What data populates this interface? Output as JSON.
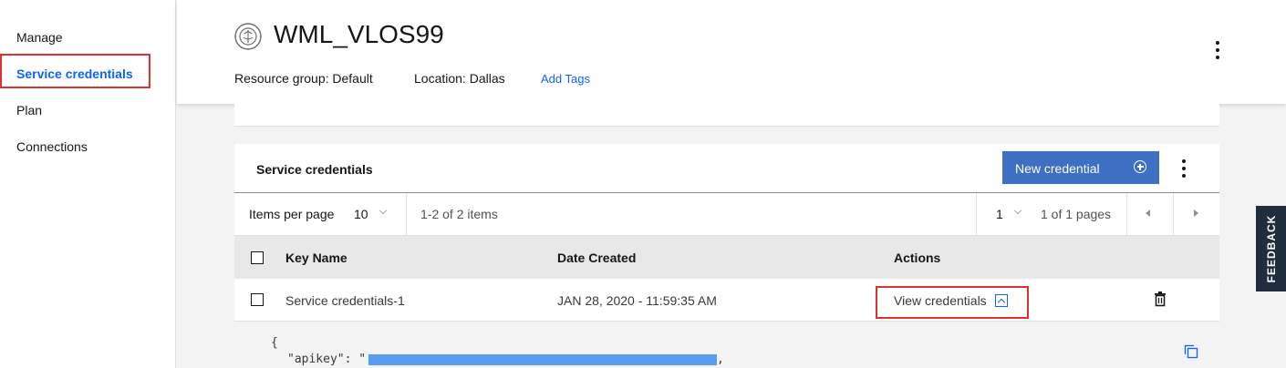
{
  "sidebar": {
    "items": [
      {
        "label": "Manage"
      },
      {
        "label": "Service credentials"
      },
      {
        "label": "Plan"
      },
      {
        "label": "Connections"
      }
    ]
  },
  "header": {
    "title": "WML_VLOS99",
    "resource_group": "Resource group: Default",
    "location": "Location: Dallas",
    "add_tags": "Add Tags"
  },
  "panel": {
    "title": "Service credentials",
    "new_button": "New credential",
    "pager": {
      "items_per_page_label": "Items per page",
      "items_per_page_value": "10",
      "range": "1-2 of 2 items",
      "page": "1",
      "pages": "1 of 1 pages"
    },
    "columns": {
      "key_name": "Key Name",
      "date_created": "Date Created",
      "actions": "Actions"
    },
    "rows": [
      {
        "key_name": "Service credentials-1",
        "date_created": "JAN 28, 2020 - 11:59:35 AM",
        "action": "View credentials"
      }
    ],
    "code": {
      "line1": "{",
      "line2_key": "\"apikey\": \"",
      "line2_end": ","
    }
  },
  "feedback": "FEEDBACK",
  "colors": {
    "accent": "#0f62fe",
    "button": "#3d70c3",
    "highlight": "#e03131",
    "feedback_bg": "#1f2d3d"
  },
  "icons": [
    "brain-icon",
    "overflow-menu-icon",
    "add-circle-icon",
    "chevron-down-icon",
    "caret-left-icon",
    "caret-right-icon",
    "chevron-up-icon",
    "trash-icon",
    "copy-icon"
  ]
}
